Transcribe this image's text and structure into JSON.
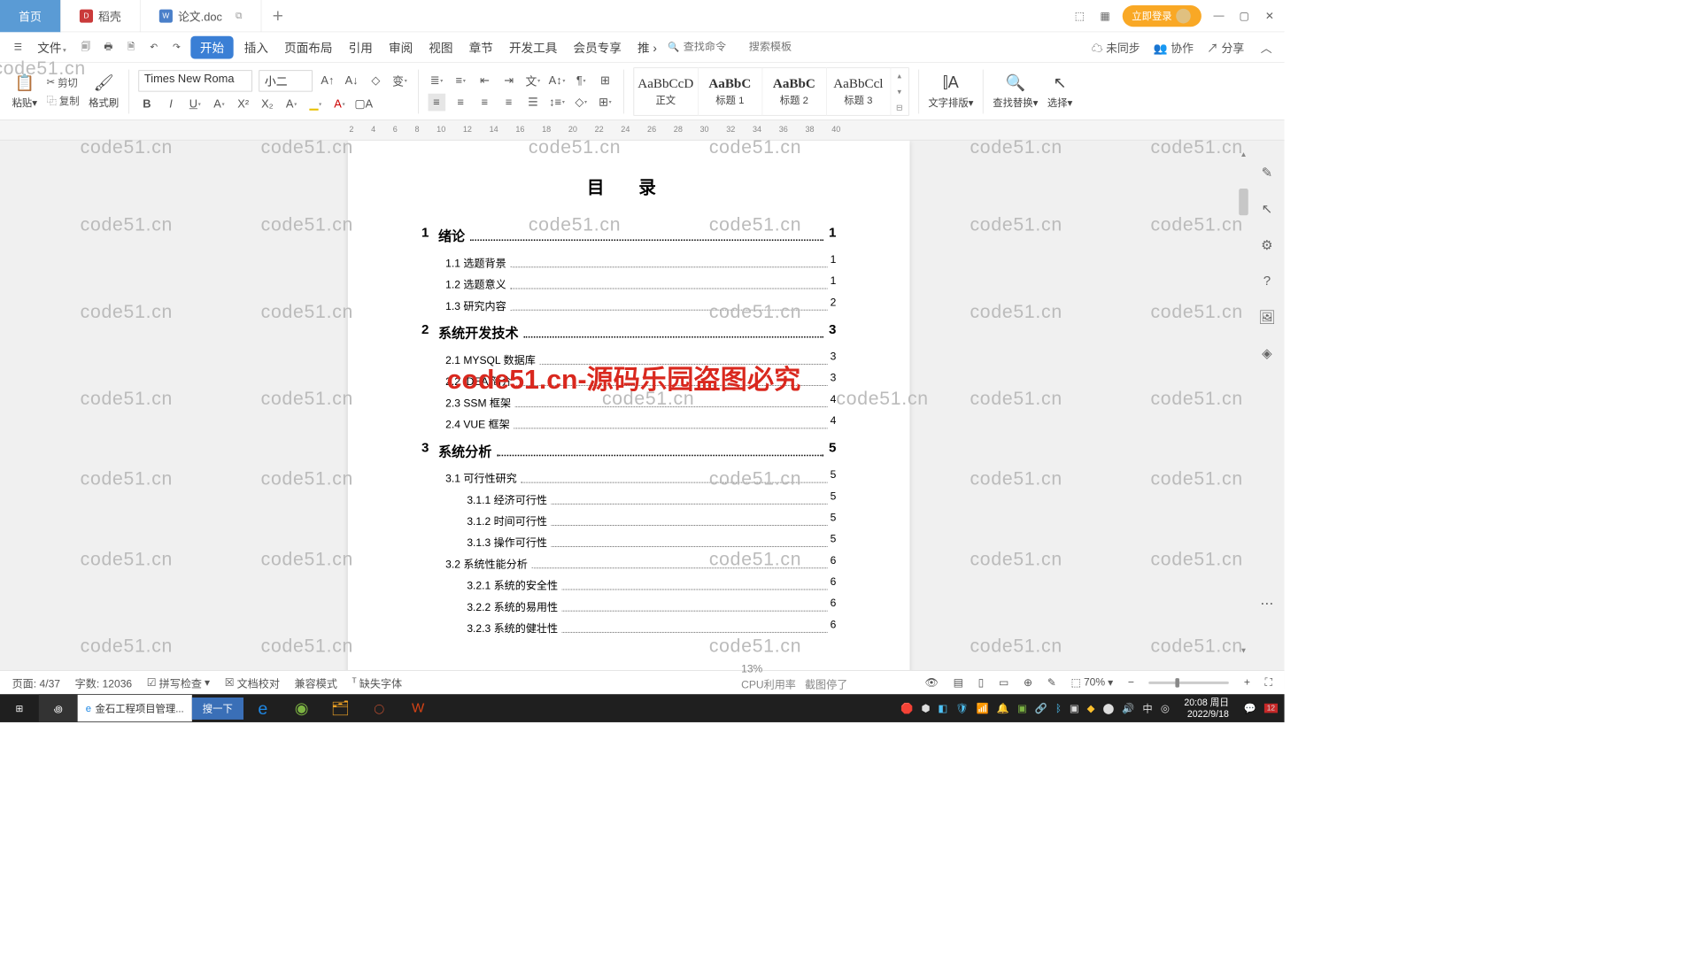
{
  "tabs": {
    "home": "首页",
    "dk": "稻壳",
    "doc": "论文.doc"
  },
  "login": "立即登录",
  "menu": {
    "file": "文件",
    "items": [
      "开始",
      "插入",
      "页面布局",
      "引用",
      "审阅",
      "视图",
      "章节",
      "开发工具",
      "会员专享",
      "推"
    ],
    "search_cmd": "查找命令",
    "search_tpl": "搜索模板",
    "unsync": "未同步",
    "collab": "协作",
    "share": "分享"
  },
  "ribbon": {
    "paste": "粘贴",
    "cut": "剪切",
    "copy": "复制",
    "brush": "格式刷",
    "font": "Times New Roma",
    "size": "小二",
    "styles": [
      {
        "prev": "AaBbCcD",
        "lbl": "正文"
      },
      {
        "prev": "AaBbC",
        "lbl": "标题 1"
      },
      {
        "prev": "AaBbC",
        "lbl": "标题 2"
      },
      {
        "prev": "AaBbCcl",
        "lbl": "标题 3"
      }
    ],
    "layout": "文字排版",
    "find": "查找替换",
    "select": "选择"
  },
  "doc": {
    "title": "目  录",
    "toc": [
      {
        "lvl": 1,
        "num": "1",
        "txt": "绪论",
        "pg": "1"
      },
      {
        "lvl": 2,
        "txt": "1.1 选题背景",
        "pg": "1"
      },
      {
        "lvl": 2,
        "txt": "1.2 选题意义",
        "pg": "1"
      },
      {
        "lvl": 2,
        "txt": "1.3 研究内容",
        "pg": "2"
      },
      {
        "lvl": 1,
        "num": "2",
        "txt": "系统开发技术",
        "pg": "3"
      },
      {
        "lvl": 2,
        "txt": "2.1 MYSQL 数据库",
        "pg": "3"
      },
      {
        "lvl": 2,
        "txt": "2.2 IDEA 简介",
        "pg": "3"
      },
      {
        "lvl": 2,
        "txt": "2.3 SSM 框架",
        "pg": "4"
      },
      {
        "lvl": 2,
        "txt": "2.4 VUE 框架",
        "pg": "4"
      },
      {
        "lvl": 1,
        "num": "3",
        "txt": "系统分析",
        "pg": "5"
      },
      {
        "lvl": 2,
        "txt": "3.1 可行性研究",
        "pg": "5"
      },
      {
        "lvl": 3,
        "txt": "3.1.1 经济可行性",
        "pg": "5"
      },
      {
        "lvl": 3,
        "txt": "3.1.2 时间可行性",
        "pg": "5"
      },
      {
        "lvl": 3,
        "txt": "3.1.3 操作可行性",
        "pg": "5"
      },
      {
        "lvl": 2,
        "txt": "3.2 系统性能分析",
        "pg": "6"
      },
      {
        "lvl": 3,
        "txt": "3.2.1 系统的安全性",
        "pg": "6"
      },
      {
        "lvl": 3,
        "txt": "3.2.2 系统的易用性",
        "pg": "6"
      },
      {
        "lvl": 3,
        "txt": "3.2.3 系统的健壮性",
        "pg": "6"
      }
    ]
  },
  "status": {
    "page": "页面: 4/37",
    "words": "字数: 12036",
    "spell": "拼写检查",
    "proof": "文档校对",
    "compat": "兼容模式",
    "missing": "缺失字体",
    "zoom": "70%"
  },
  "taskbar": {
    "ie": "金石工程项目管理...",
    "search": "搜一下",
    "cpu": "CPU利用率",
    "pct": "13%",
    "paused": "截图停了",
    "time": "20:08 周日",
    "date": "2022/9/18",
    "ime": "中"
  },
  "wm": "code51.cn",
  "wm_red": "code51.cn-源码乐园盗图必究"
}
